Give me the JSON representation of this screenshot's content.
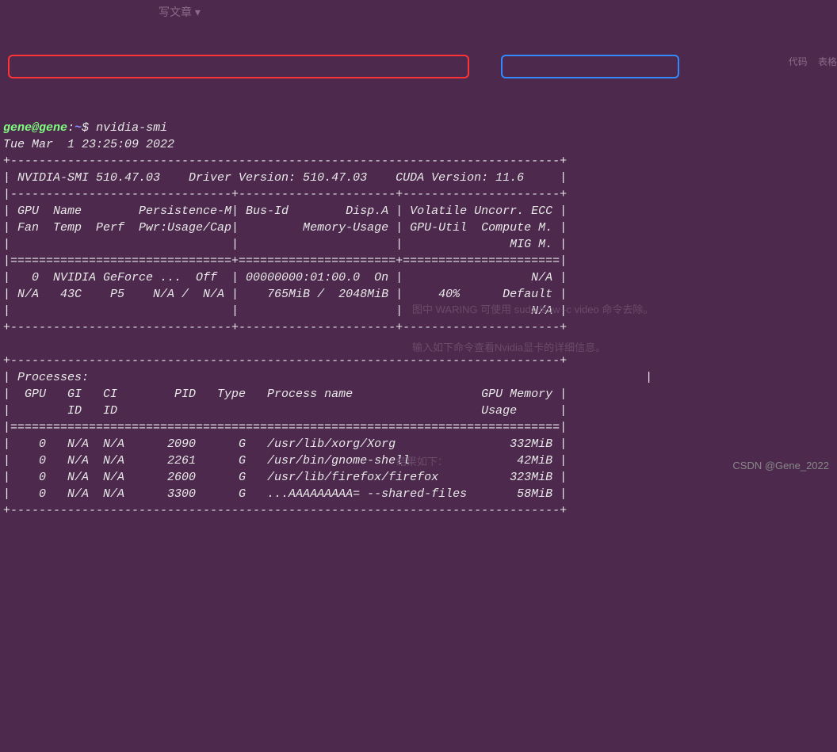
{
  "prompt": {
    "user": "gene@gene",
    "separator": ":",
    "path": "~",
    "dollar": "$",
    "command": "nvidia-smi"
  },
  "timestamp": "Tue Mar  1 23:25:09 2022",
  "header": {
    "smi_version": "NVIDIA-SMI 510.47.03",
    "driver_version": "Driver Version: 510.47.03",
    "cuda_version": "CUDA Version: 11.6"
  },
  "gpu_table_header": {
    "row1": "| GPU  Name        Persistence-M| Bus-Id        Disp.A | Volatile Uncorr. ECC |",
    "row2": "| Fan  Temp  Perf  Pwr:Usage/Cap|         Memory-Usage | GPU-Util  Compute M. |",
    "row3": "|                               |                      |               MIG M. |"
  },
  "gpu_data": {
    "id": "0",
    "name": "NVIDIA GeForce ...",
    "persistence": "Off",
    "bus_id": "00000000:01:00.0",
    "disp_a": "On",
    "ecc": "N/A",
    "fan": "N/A",
    "temp": "43C",
    "perf": "P5",
    "pwr_usage": "N/A",
    "pwr_cap": "N/A",
    "mem_used": "765MiB",
    "mem_total": "2048MiB",
    "gpu_util": "40%",
    "compute_m": "Default",
    "mig_m": "N/A"
  },
  "gpu_row1": "|   0  NVIDIA GeForce ...  Off  | 00000000:01:00.0  On |                  N/A |",
  "gpu_row2": "| N/A   43C    P5    N/A /  N/A |    765MiB /  2048MiB |     40%      Default |",
  "gpu_row3": "|                               |                      |                  N/A |",
  "processes_label": "| Processes:",
  "processes_header1": "|  GPU   GI   CI        PID   Type   Process name                  GPU Memory |",
  "processes_header2": "|        ID   ID                                                   Usage      |",
  "processes": [
    {
      "gpu": "0",
      "gi": "N/A",
      "ci": "N/A",
      "pid": "2090",
      "type": "G",
      "name": "/usr/lib/xorg/Xorg",
      "memory": "332MiB"
    },
    {
      "gpu": "0",
      "gi": "N/A",
      "ci": "N/A",
      "pid": "2261",
      "type": "G",
      "name": "/usr/bin/gnome-shell",
      "memory": "42MiB"
    },
    {
      "gpu": "0",
      "gi": "N/A",
      "ci": "N/A",
      "pid": "2600",
      "type": "G",
      "name": "/usr/lib/firefox/firefox",
      "memory": "323MiB"
    },
    {
      "gpu": "0",
      "gi": "N/A",
      "ci": "N/A",
      "pid": "3300",
      "type": "G",
      "name": "...AAAAAAAAA= --shared-files",
      "memory": "58MiB"
    }
  ],
  "proc_rows": [
    "|    0   N/A  N/A      2090      G   /usr/lib/xorg/Xorg                332MiB |",
    "|    0   N/A  N/A      2261      G   /usr/bin/gnome-shell               42MiB |",
    "|    0   N/A  N/A      2600      G   /usr/lib/firefox/firefox          323MiB |",
    "|    0   N/A  N/A      3300      G   ...AAAAAAAAA= --shared-files       58MiB |"
  ],
  "dividers": {
    "top": "+-----------------------------------------------------------------------------+",
    "mid": "|-------------------------------+----------------------+----------------------+",
    "eq": "|===============================+======================+======================|",
    "bottom": "+-------------------------------+----------------------+----------------------+",
    "proc_top": "+-----------------------------------------------------------------------------+",
    "proc_eq": "|=============================================================================|",
    "proc_bottom": "+-----------------------------------------------------------------------------+",
    "proc_close": "|                                                                             |"
  },
  "header_line": "| NVIDIA-SMI 510.47.03    Driver Version: 510.47.03    CUDA Version: 11.6     |",
  "proc_close_pipe": "                                                                              |",
  "background": {
    "top_title": "写文章 ▾",
    "toolbar_items": "代码    表格",
    "text3": "图中 WARING 可使用 sudo lshw -c video 命令去除。",
    "text4": "输入如下命令查看Nvidia显卡的详细信息。",
    "text5": "结果如下："
  },
  "watermark": "CSDN @Gene_2022"
}
